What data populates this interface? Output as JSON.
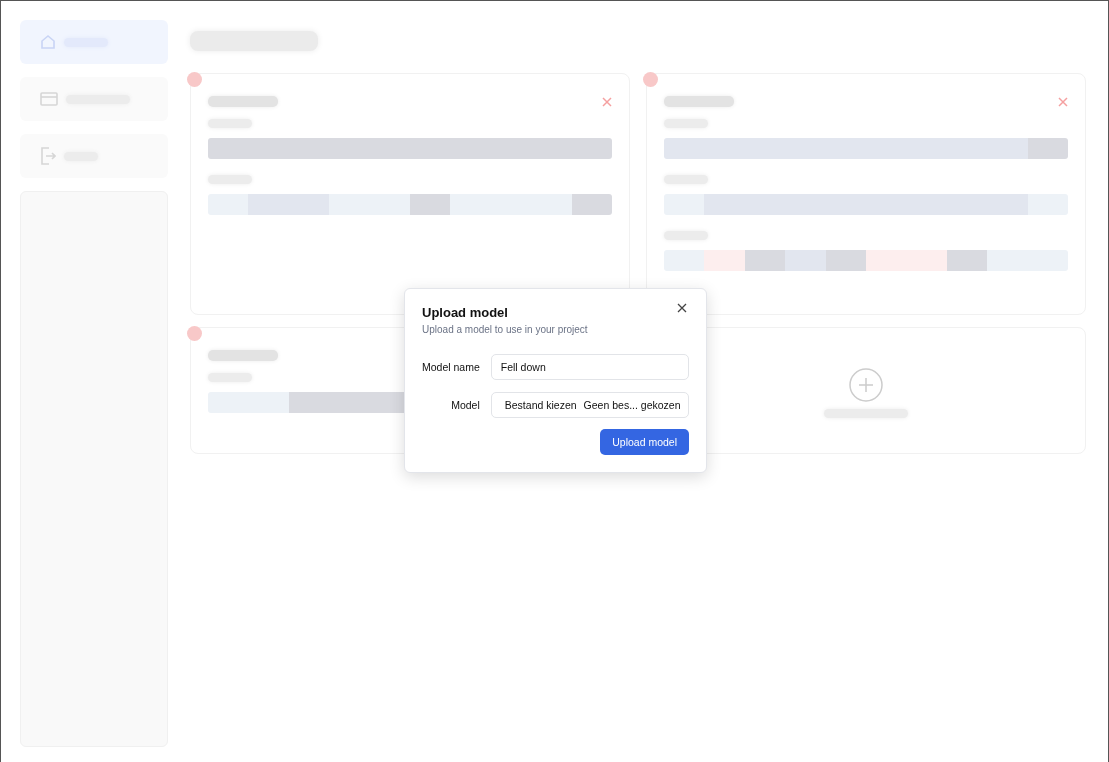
{
  "sidebar": {
    "items": [
      {
        "selected": true
      },
      {
        "selected": false
      },
      {
        "selected": false
      }
    ]
  },
  "cards": [
    {
      "kind": "model",
      "remove_button": true,
      "classes": [
        {
          "segments": [
            {
              "color": "#d9dae0"
            },
            {
              "color": "#d9dae0"
            },
            {
              "color": "#d9dae0"
            },
            {
              "color": "#d9dae0"
            },
            {
              "color": "#d9dae0"
            },
            {
              "color": "#d9dae0"
            },
            {
              "color": "#d9dae0"
            },
            {
              "color": "#d9dae0"
            },
            {
              "color": "#d9dae0"
            },
            {
              "color": "#d9dae0"
            }
          ]
        },
        {
          "segments": [
            {
              "color": "#edf2f7"
            },
            {
              "color": "#e2e6ef"
            },
            {
              "color": "#e2e6ef"
            },
            {
              "color": "#edf2f7"
            },
            {
              "color": "#edf2f7"
            },
            {
              "color": "#d9dae0"
            },
            {
              "color": "#edf2f7"
            },
            {
              "color": "#edf2f7"
            },
            {
              "color": "#edf2f7"
            },
            {
              "color": "#d9dae0"
            }
          ]
        }
      ]
    },
    {
      "kind": "model",
      "remove_button": true,
      "classes": [
        {
          "segments": [
            {
              "color": "#e2e6ef"
            },
            {
              "color": "#e2e6ef"
            },
            {
              "color": "#e2e6ef"
            },
            {
              "color": "#e2e6ef"
            },
            {
              "color": "#e2e6ef"
            },
            {
              "color": "#e2e6ef"
            },
            {
              "color": "#e2e6ef"
            },
            {
              "color": "#e2e6ef"
            },
            {
              "color": "#e2e6ef"
            },
            {
              "color": "#d9dae0"
            }
          ]
        },
        {
          "segments": [
            {
              "color": "#edf2f7"
            },
            {
              "color": "#e2e6ef"
            },
            {
              "color": "#e2e6ef"
            },
            {
              "color": "#e2e6ef"
            },
            {
              "color": "#e2e6ef"
            },
            {
              "color": "#e2e6ef"
            },
            {
              "color": "#e2e6ef"
            },
            {
              "color": "#e2e6ef"
            },
            {
              "color": "#e2e6ef"
            },
            {
              "color": "#edf2f7"
            }
          ]
        },
        {
          "segments": [
            {
              "color": "#edf2f7"
            },
            {
              "color": "#fdeeee"
            },
            {
              "color": "#d9dae0"
            },
            {
              "color": "#e2e6ef"
            },
            {
              "color": "#d9dae0"
            },
            {
              "color": "#fdeeee"
            },
            {
              "color": "#fdeeee"
            },
            {
              "color": "#d9dae0"
            },
            {
              "color": "#edf2f7"
            },
            {
              "color": "#edf2f7"
            }
          ]
        }
      ]
    },
    {
      "kind": "model",
      "classes": [
        {
          "segments": [
            {
              "color": "#edf2f7"
            },
            {
              "color": "#edf2f7"
            },
            {
              "color": "#d9dae0"
            },
            {
              "color": "#d9dae0"
            },
            {
              "color": "#d9dae0"
            }
          ]
        }
      ]
    },
    {
      "kind": "upload"
    }
  ],
  "dialog": {
    "title": "Upload model",
    "subtitle": "Upload a model to use in your project",
    "fields": [
      {
        "kind": "text",
        "label": "Model name",
        "value": "Fell down"
      },
      {
        "kind": "file",
        "label": "Model",
        "button": "Bestand kiezen",
        "status": "Geen bes... gekozen"
      }
    ],
    "submit": "Upload model"
  }
}
